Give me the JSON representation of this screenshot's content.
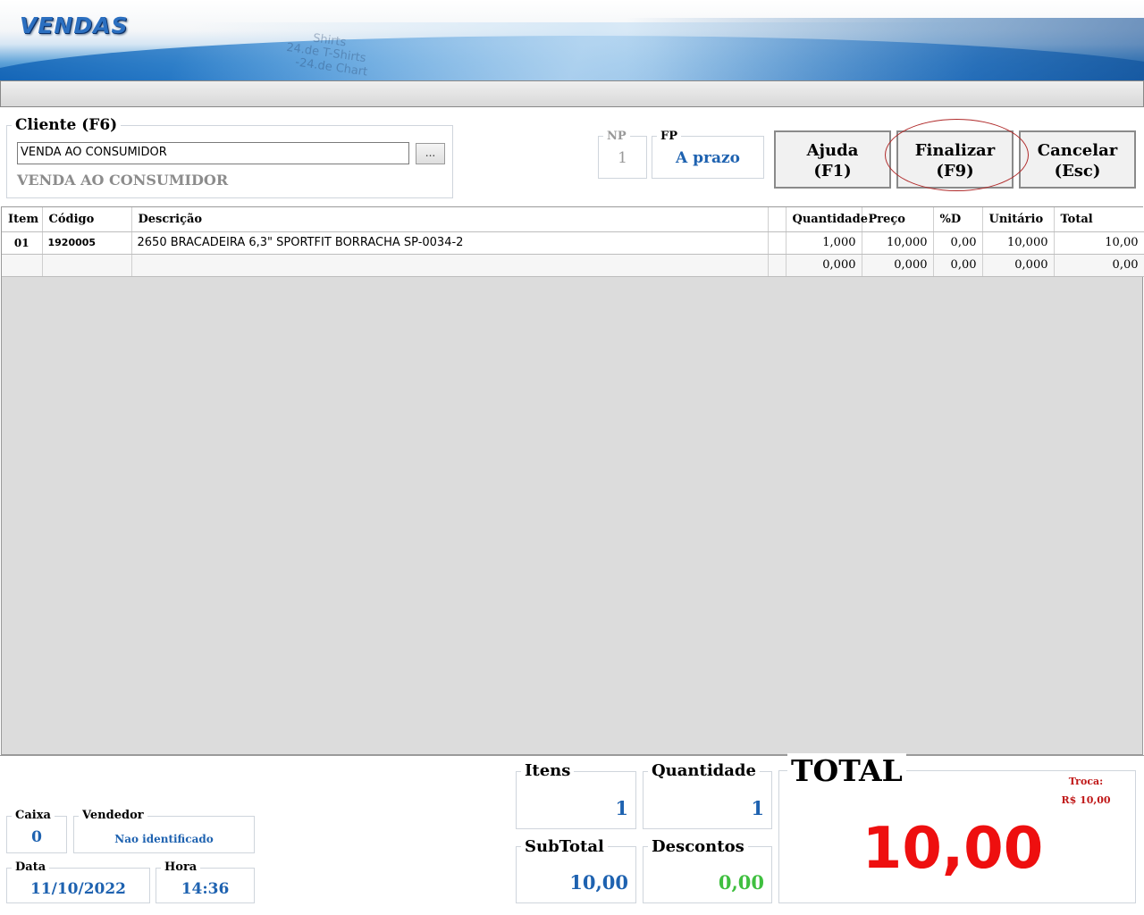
{
  "app": {
    "title": "VENDAS"
  },
  "banner_ghost": [
    "Shirts",
    "24.de T-Shirts",
    "-24.de Chart"
  ],
  "client": {
    "label": "Cliente (F6)",
    "input_value": "VENDA AO CONSUMIDOR",
    "browse_label": "...",
    "name": "VENDA AO CONSUMIDOR"
  },
  "np": {
    "label": "NP",
    "value": "1"
  },
  "fp": {
    "label": "FP",
    "value": "A prazo"
  },
  "buttons": {
    "help": {
      "line1": "Ajuda",
      "line2": "(F1)"
    },
    "finish": {
      "line1": "Finalizar",
      "line2": "(F9)"
    },
    "cancel": {
      "line1": "Cancelar",
      "line2": "(Esc)"
    }
  },
  "grid": {
    "headers": [
      "Item",
      "Código",
      "Descrição",
      "",
      "Quantidade",
      "Preço",
      "%D",
      "Unitário",
      "Total"
    ],
    "rows": [
      [
        "01",
        "1920005",
        "2650 BRACADEIRA 6,3\" SPORTFIT BORRACHA SP-0034-2",
        "",
        "1,000",
        "10,000",
        "0,00",
        "10,000",
        "10,00"
      ],
      [
        "",
        "",
        "",
        "",
        "0,000",
        "0,000",
        "0,00",
        "0,000",
        "0,00"
      ]
    ]
  },
  "footer": {
    "caixa": {
      "label": "Caixa",
      "value": "0"
    },
    "vendedor": {
      "label": "Vendedor",
      "value": "Nao identificado"
    },
    "data": {
      "label": "Data",
      "value": "11/10/2022"
    },
    "hora": {
      "label": "Hora",
      "value": "14:36"
    },
    "itens": {
      "label": "Itens",
      "value": "1"
    },
    "quantidade": {
      "label": "Quantidade",
      "value": "1"
    },
    "subtotal": {
      "label": "SubTotal",
      "value": "10,00"
    },
    "descontos": {
      "label": "Descontos",
      "value": "0,00"
    },
    "total": {
      "label": "TOTAL",
      "value": "10,00",
      "troco_label": "Troca:",
      "troco_value": "R$ 10,00"
    }
  },
  "colors": {
    "accent_blue": "#1e62b0",
    "total_red": "#ee0f0f",
    "discount_green": "#3fbf3f",
    "edit_cell": "#3b8fe8"
  }
}
